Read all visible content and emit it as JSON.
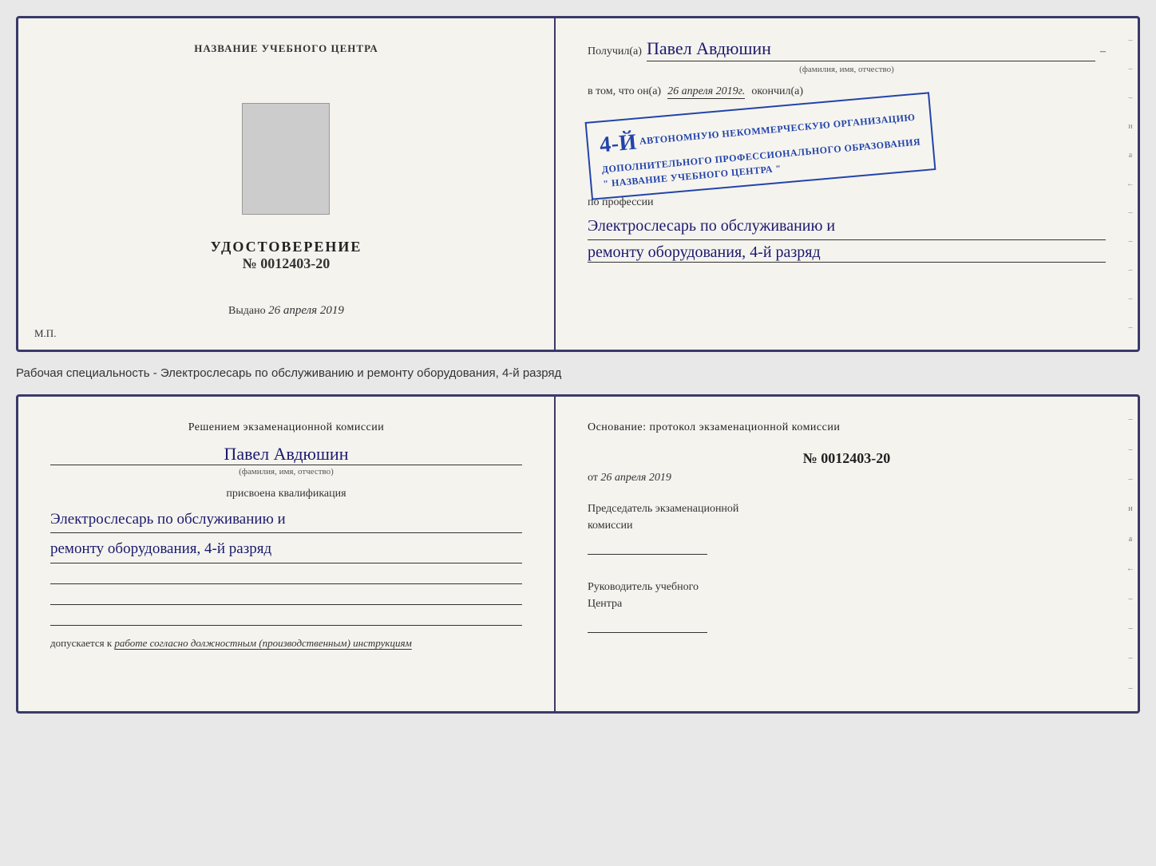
{
  "top_document": {
    "left": {
      "title": "НАЗВАНИЕ УЧЕБНОГО ЦЕНТРА",
      "photo_alt": "фото",
      "doc_type": "УДОСТОВЕРЕНИЕ",
      "doc_number": "№ 0012403-20",
      "vydano_label": "Выдано",
      "vydano_value": "26 апреля 2019",
      "mp_label": "М.П."
    },
    "right": {
      "poluchil_label": "Получил(a)",
      "recipient_name": "Павел Авдюшин",
      "fio_subtitle": "(фамилия, имя, отчество)",
      "vtom_label": "в том, что он(а)",
      "date_value": "26 апреля 2019г.",
      "okonchil_label": "окончил(а)",
      "stamp_grade": "4-й",
      "stamp_line1": "АВТОНОМНУЮ НЕКОММЕРЧЕСКУЮ ОРГАНИЗАЦИЮ",
      "stamp_line2": "ДОПОЛНИТЕЛЬНОГО ПРОФЕССИОНАЛЬНОГО ОБРАЗОВАНИЯ",
      "stamp_line3": "\" НАЗВАНИЕ УЧЕБНОГО ЦЕНТРА \"",
      "po_professii_label": "по профессии",
      "profession_line1": "Электрослесарь по обслуживанию и",
      "profession_line2": "ремонту оборудования, 4-й разряд"
    }
  },
  "middle_text": "Рабочая специальность - Электрослесарь по обслуживанию и ремонту оборудования, 4-й разряд",
  "bottom_document": {
    "left": {
      "reshenie_text": "Решением экзаменационной комиссии",
      "recipient_name": "Павел Авдюшин",
      "fio_subtitle": "(фамилия, имя, отчество)",
      "prisvoena_label": "присвоена квалификация",
      "qualification_line1": "Электрослесарь по обслуживанию и",
      "qualification_line2": "ремонту оборудования, 4-й разряд",
      "dopuskaetsya_label": "допускается к",
      "dopuskaetsya_value": "работе согласно должностным (производственным) инструкциям"
    },
    "right": {
      "osnovanie_text": "Основание: протокол экзаменационной комиссии",
      "protocol_number": "№ 0012403-20",
      "ot_label": "от",
      "ot_value": "26 апреля 2019",
      "predsedatel_line1": "Председатель экзаменационной",
      "predsedatel_line2": "комиссии",
      "rukovoditel_line1": "Руководитель учебного",
      "rukovoditel_line2": "Центра"
    }
  },
  "right_edge_markers": [
    "и",
    "а",
    "←",
    "–",
    "–",
    "–",
    "–"
  ],
  "right_edge_markers_bottom": [
    "и",
    "а",
    "←",
    "–",
    "–",
    "–",
    "–"
  ]
}
